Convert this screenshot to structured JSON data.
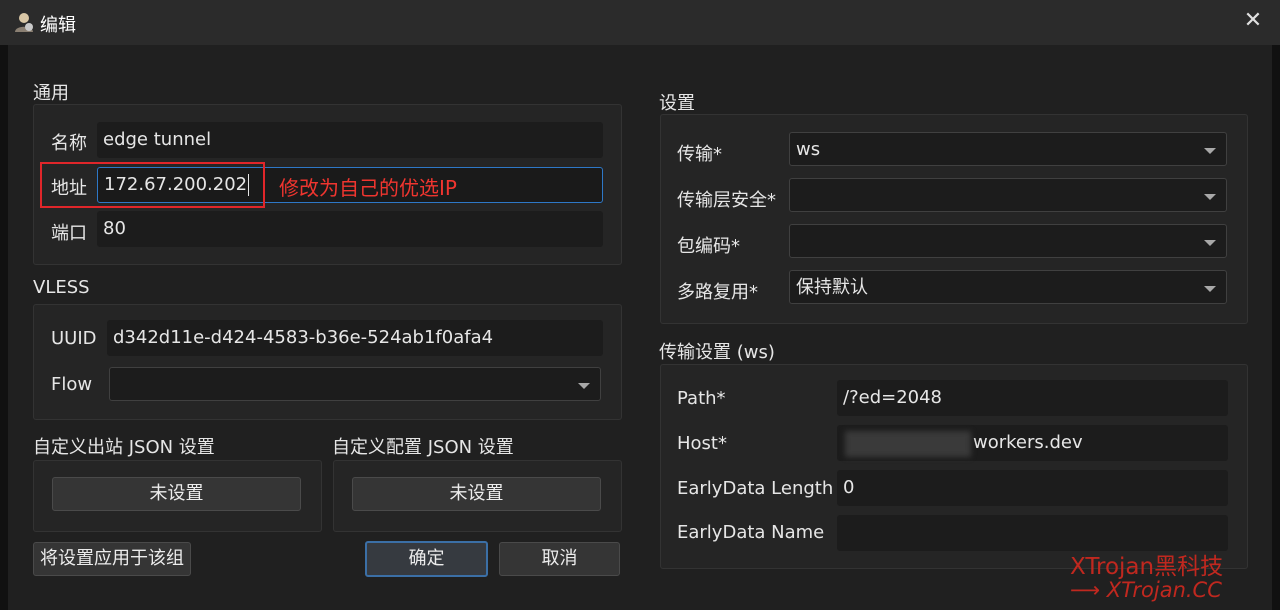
{
  "window": {
    "title": "编辑"
  },
  "general": {
    "title": "通用",
    "name_label": "名称",
    "name_value": "edge tunnel",
    "address_label": "地址",
    "address_value": "172.67.200.202",
    "port_label": "端口",
    "port_value": "80"
  },
  "annotation": "修改为自己的优选IP",
  "vless": {
    "title": "VLESS",
    "uuid_label": "UUID",
    "uuid_value": "d342d11e-d424-4583-b36e-524ab1f0afa4",
    "flow_label": "Flow",
    "flow_value": ""
  },
  "custom_outbound": {
    "title": "自定义出站 JSON 设置",
    "button": "未设置"
  },
  "custom_config": {
    "title": "自定义配置 JSON 设置",
    "button": "未设置"
  },
  "buttons": {
    "apply_group": "将设置应用于该组",
    "ok": "确定",
    "cancel": "取消"
  },
  "settings": {
    "title": "设置",
    "transport_label": "传输*",
    "transport_value": "ws",
    "security_label": "传输层安全*",
    "security_value": "",
    "packet_label": "包编码*",
    "packet_value": "",
    "mux_label": "多路复用*",
    "mux_value": "保持默认"
  },
  "transport_settings": {
    "title": "传输设置 (ws)",
    "path_label": "Path*",
    "path_value": "/?ed=2048",
    "host_label": "Host*",
    "host_value": "workers.dev",
    "early_len_label": "EarlyData Length",
    "early_len_value": "0",
    "early_name_label": "EarlyData Name",
    "early_name_value": ""
  },
  "watermark": {
    "line1": "XTrojan黑科技",
    "line2": "XTrojan.CC",
    "arrow": "⟶"
  },
  "icons": {
    "close": "close-icon",
    "app": "user-icon",
    "dropdown": "chevron-down-icon"
  }
}
